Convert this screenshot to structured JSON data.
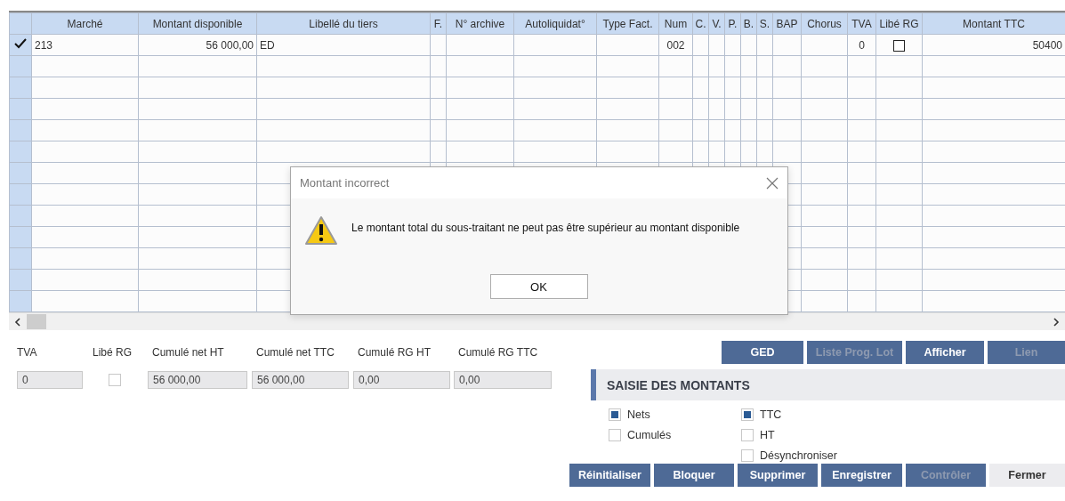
{
  "table": {
    "columns": [
      "Marché",
      "Montant disponible",
      "Libellé du tiers",
      "F.",
      "N° archive",
      "Autoliquidat°",
      "Type Fact.",
      "Num",
      "C.",
      "V.",
      "P.",
      "B.",
      "S.",
      "BAP",
      "Chorus",
      "TVA",
      "Libé RG",
      "Montant TTC"
    ],
    "rows": [
      {
        "selected": true,
        "cells": [
          "213",
          "56 000,00",
          "ED",
          null,
          null,
          null,
          null,
          "002",
          null,
          null,
          null,
          null,
          null,
          null,
          null,
          "0",
          {
            "kind": "checkbox",
            "checked": false
          },
          "50400"
        ]
      },
      {
        "selected": false
      },
      {
        "selected": false
      },
      {
        "selected": false
      },
      {
        "selected": false
      },
      {
        "selected": false
      },
      {
        "selected": false
      },
      {
        "selected": false
      },
      {
        "selected": false
      },
      {
        "selected": false
      },
      {
        "selected": false
      },
      {
        "selected": false
      },
      {
        "selected": false
      }
    ]
  },
  "totals": [
    {
      "label": "TVA",
      "kind": "field",
      "value": "0"
    },
    {
      "label": "Libé RG",
      "kind": "checkbox",
      "checked": false
    },
    {
      "label": "Cumulé net HT",
      "kind": "field",
      "value": "56 000,00"
    },
    {
      "label": "Cumulé net TTC",
      "kind": "field",
      "value": "56 000,00"
    },
    {
      "label": "Cumulé RG HT",
      "kind": "field",
      "value": "0,00"
    },
    {
      "label": "Cumulé RG TTC",
      "kind": "field",
      "value": "0,00"
    }
  ],
  "top_buttons": [
    {
      "label": "GED",
      "disabled": false
    },
    {
      "label": "Liste Prog. Lot",
      "disabled": true
    },
    {
      "label": "Afficher",
      "disabled": false
    },
    {
      "label": "Lien",
      "disabled": true
    }
  ],
  "section": {
    "title": "SAISIE DES MONTANTS",
    "option_groups": [
      {
        "options": [
          {
            "label": "Nets",
            "checked": true
          },
          {
            "label": "Cumulés",
            "checked": false
          }
        ]
      },
      {
        "options": [
          {
            "label": "TTC",
            "checked": true
          },
          {
            "label": "HT",
            "checked": false
          },
          {
            "label": "Désynchroniser",
            "checked": false
          }
        ]
      }
    ]
  },
  "bottom_buttons": [
    {
      "label": "Réinitialiser",
      "kind": "primary",
      "disabled": false
    },
    {
      "label": "Bloquer",
      "kind": "primary",
      "disabled": false
    },
    {
      "label": "Supprimer",
      "kind": "primary",
      "disabled": false
    },
    {
      "label": "Enregistrer",
      "kind": "primary",
      "disabled": false
    },
    {
      "label": "Contrôler",
      "kind": "primary",
      "disabled": true
    },
    {
      "label": "Fermer",
      "kind": "secondary",
      "disabled": false
    }
  ],
  "dialog": {
    "title": "Montant incorrect",
    "message": "Le montant total du sous-traitant ne peut pas être supérieur au montant disponible",
    "buttons": [
      "OK"
    ]
  }
}
